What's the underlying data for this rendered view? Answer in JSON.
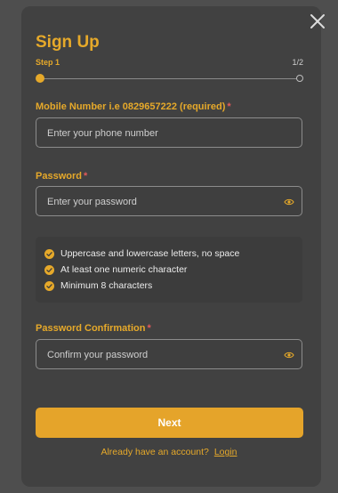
{
  "modal": {
    "title": "Sign Up"
  },
  "step": {
    "label": "Step 1",
    "count": "1/2"
  },
  "mobile": {
    "label": "Mobile Number i.e 0829657222 (required)",
    "required_mark": "*",
    "placeholder": "Enter your phone number"
  },
  "password": {
    "label": "Password",
    "required_mark": "*",
    "placeholder": "Enter your password"
  },
  "requirements": {
    "items": [
      "Uppercase and lowercase letters, no space",
      "At least one numeric character",
      "Minimum 8 characters"
    ]
  },
  "confirm": {
    "label": "Password Confirmation",
    "required_mark": "*",
    "placeholder": "Confirm your password"
  },
  "actions": {
    "next_label": "Next"
  },
  "footer": {
    "prompt": "Already have an account?",
    "login_label": "Login"
  },
  "colors": {
    "accent": "#e6a92a",
    "required": "#e25a5a",
    "background": "#414141"
  },
  "icons": {
    "close": "close-icon",
    "eye": "eye-icon",
    "check": "check-circle-icon"
  }
}
